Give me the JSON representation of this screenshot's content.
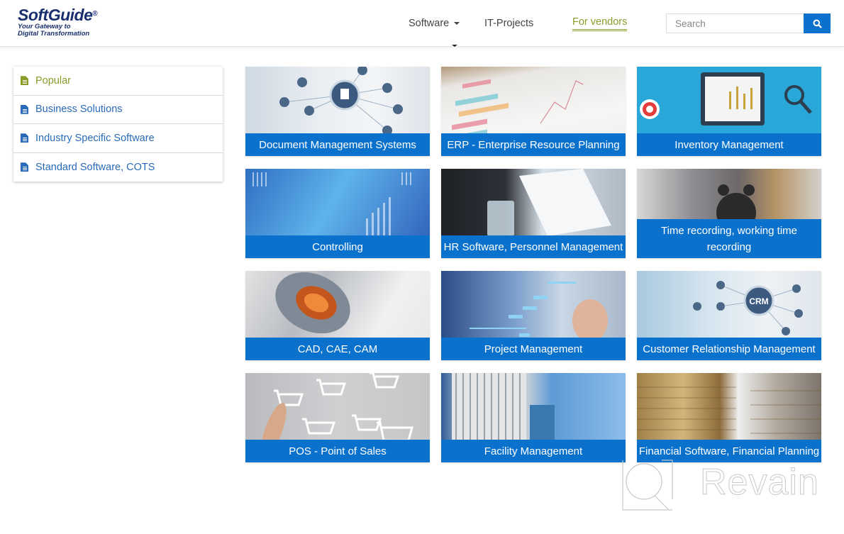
{
  "header": {
    "logo": {
      "brand": "SoftGuide",
      "registered": "®",
      "tagline_line1": "Your Gateway to",
      "tagline_line2": "Digital Transformation"
    },
    "nav": [
      {
        "label": "Software",
        "has_dropdown": true
      },
      {
        "label": "IT-Projects"
      },
      {
        "label": "For vendors",
        "active": true
      }
    ],
    "search": {
      "placeholder": "Search",
      "value": "",
      "button_icon": "search-icon"
    }
  },
  "sidebar": {
    "items": [
      {
        "label": "Popular",
        "icon": "document-icon",
        "active": true
      },
      {
        "label": "Business Solutions",
        "icon": "document-icon"
      },
      {
        "label": "Industry Specific Software",
        "icon": "document-icon"
      },
      {
        "label": "Standard Software, COTS",
        "icon": "document-icon"
      }
    ]
  },
  "categories": [
    {
      "label": "Document Management Systems",
      "image": "network-hand-document"
    },
    {
      "label": "ERP - Enterprise Resource Planning",
      "image": "charts-paper"
    },
    {
      "label": "Inventory Management",
      "image": "tablet-analytics-illustration"
    },
    {
      "label": "Controlling",
      "image": "blue-bar-graphs"
    },
    {
      "label": "HR Software, Personnel Management",
      "image": "business-papers-glass"
    },
    {
      "label": "Time recording, working time recording",
      "image": "alarm-clock"
    },
    {
      "label": "CAD, CAE, CAM",
      "image": "electric-motor-cutaway"
    },
    {
      "label": "Project Management",
      "image": "gantt-finger"
    },
    {
      "label": "Customer Relationship Management",
      "image": "crm-network"
    },
    {
      "label": "POS - Point of Sales",
      "image": "shopping-carts"
    },
    {
      "label": "Facility Management",
      "image": "skyscrapers"
    },
    {
      "label": "Financial Software, Financial Planning",
      "image": "coin-stacks"
    }
  ],
  "watermark": {
    "text": "Revain"
  },
  "colors": {
    "primary_blue": "#0a72cc",
    "link_blue": "#2a6ab8",
    "active_green": "#8c9b2a",
    "logo_navy": "#1a2f6e"
  }
}
